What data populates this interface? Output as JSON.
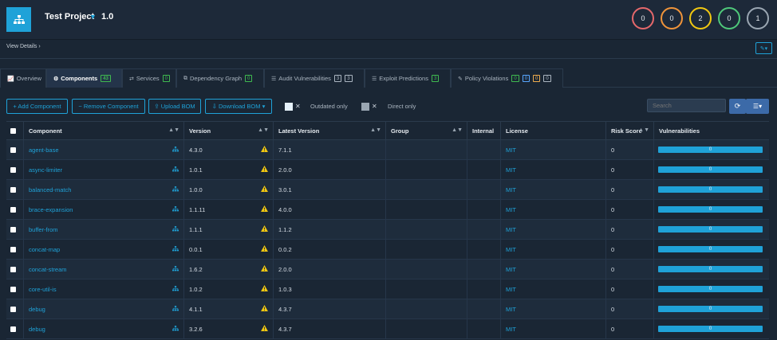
{
  "project": {
    "name": "Test Project",
    "version": "1.0"
  },
  "severity_circles": [
    {
      "value": "0",
      "color": "#e5686b",
      "name": "critical"
    },
    {
      "value": "0",
      "color": "#f0943a",
      "name": "high"
    },
    {
      "value": "2",
      "color": "#f2c811",
      "name": "medium"
    },
    {
      "value": "0",
      "color": "#4fc87a",
      "name": "low"
    },
    {
      "value": "1",
      "color": "#9aa6b2",
      "name": "unassigned"
    }
  ],
  "subbar": {
    "view_details": "View Details ›"
  },
  "tabs": [
    {
      "label": "Overview",
      "icon": "chart-line-icon",
      "glyph": "📈",
      "badges": []
    },
    {
      "label": "Components",
      "icon": "cubes-icon",
      "glyph": "⚙",
      "badges": [
        {
          "value": "43",
          "color": "green"
        }
      ]
    },
    {
      "label": "Services",
      "icon": "exchange-icon",
      "glyph": "⇄",
      "badges": [
        {
          "value": "0",
          "color": "green"
        }
      ]
    },
    {
      "label": "Dependency Graph",
      "icon": "sitemap-icon",
      "glyph": "⧉",
      "badges": [
        {
          "value": "0",
          "color": "green"
        }
      ]
    },
    {
      "label": "Audit Vulnerabilities",
      "icon": "list-icon",
      "glyph": "☰",
      "badges": [
        {
          "value": "3",
          "color": "grey"
        },
        {
          "value": "3",
          "color": "grey"
        }
      ]
    },
    {
      "label": "Exploit Predictions",
      "icon": "list-alt-icon",
      "glyph": "☰",
      "badges": [
        {
          "value": "3",
          "color": "green"
        }
      ]
    },
    {
      "label": "Policy Violations",
      "icon": "pencil-icon",
      "glyph": "✎",
      "badges": [
        {
          "value": "0",
          "color": "green"
        },
        {
          "value": "0",
          "color": "blue"
        },
        {
          "value": "0",
          "color": "yellow"
        },
        {
          "value": "0",
          "color": "grey"
        }
      ]
    }
  ],
  "toolbar": {
    "add_component": "+ Add Component",
    "remove_component": "− Remove Component",
    "upload_bom": "⇪ Upload BOM",
    "download_bom": "⇩ Download BOM ▾",
    "outdated_only": "Outdated only",
    "direct_only": "Direct only",
    "search_placeholder": "Search"
  },
  "table": {
    "headers": {
      "component": "Component",
      "version": "Version",
      "latest_version": "Latest Version",
      "group": "Group",
      "internal": "Internal",
      "license": "License",
      "risk_score": "Risk Score",
      "vulnerabilities": "Vulnerabilities"
    },
    "rows": [
      {
        "component": "agent-base",
        "version": "4.3.0",
        "latest": "7.1.1",
        "group": "",
        "internal": "",
        "license": "MIT",
        "risk": "0",
        "vulns": "0"
      },
      {
        "component": "async-limiter",
        "version": "1.0.1",
        "latest": "2.0.0",
        "group": "",
        "internal": "",
        "license": "MIT",
        "risk": "0",
        "vulns": "0"
      },
      {
        "component": "balanced-match",
        "version": "1.0.0",
        "latest": "3.0.1",
        "group": "",
        "internal": "",
        "license": "MIT",
        "risk": "0",
        "vulns": "0"
      },
      {
        "component": "brace-expansion",
        "version": "1.1.11",
        "latest": "4.0.0",
        "group": "",
        "internal": "",
        "license": "MIT",
        "risk": "0",
        "vulns": "0"
      },
      {
        "component": "buffer-from",
        "version": "1.1.1",
        "latest": "1.1.2",
        "group": "",
        "internal": "",
        "license": "MIT",
        "risk": "0",
        "vulns": "0"
      },
      {
        "component": "concat-map",
        "version": "0.0.1",
        "latest": "0.0.2",
        "group": "",
        "internal": "",
        "license": "MIT",
        "risk": "0",
        "vulns": "0"
      },
      {
        "component": "concat-stream",
        "version": "1.6.2",
        "latest": "2.0.0",
        "group": "",
        "internal": "",
        "license": "MIT",
        "risk": "0",
        "vulns": "0"
      },
      {
        "component": "core-util-is",
        "version": "1.0.2",
        "latest": "1.0.3",
        "group": "",
        "internal": "",
        "license": "MIT",
        "risk": "0",
        "vulns": "0"
      },
      {
        "component": "debug",
        "version": "4.1.1",
        "latest": "4.3.7",
        "group": "",
        "internal": "",
        "license": "MIT",
        "risk": "0",
        "vulns": "0"
      },
      {
        "component": "debug",
        "version": "3.2.6",
        "latest": "4.3.7",
        "group": "",
        "internal": "",
        "license": "MIT",
        "risk": "0",
        "vulns": "0"
      }
    ]
  }
}
